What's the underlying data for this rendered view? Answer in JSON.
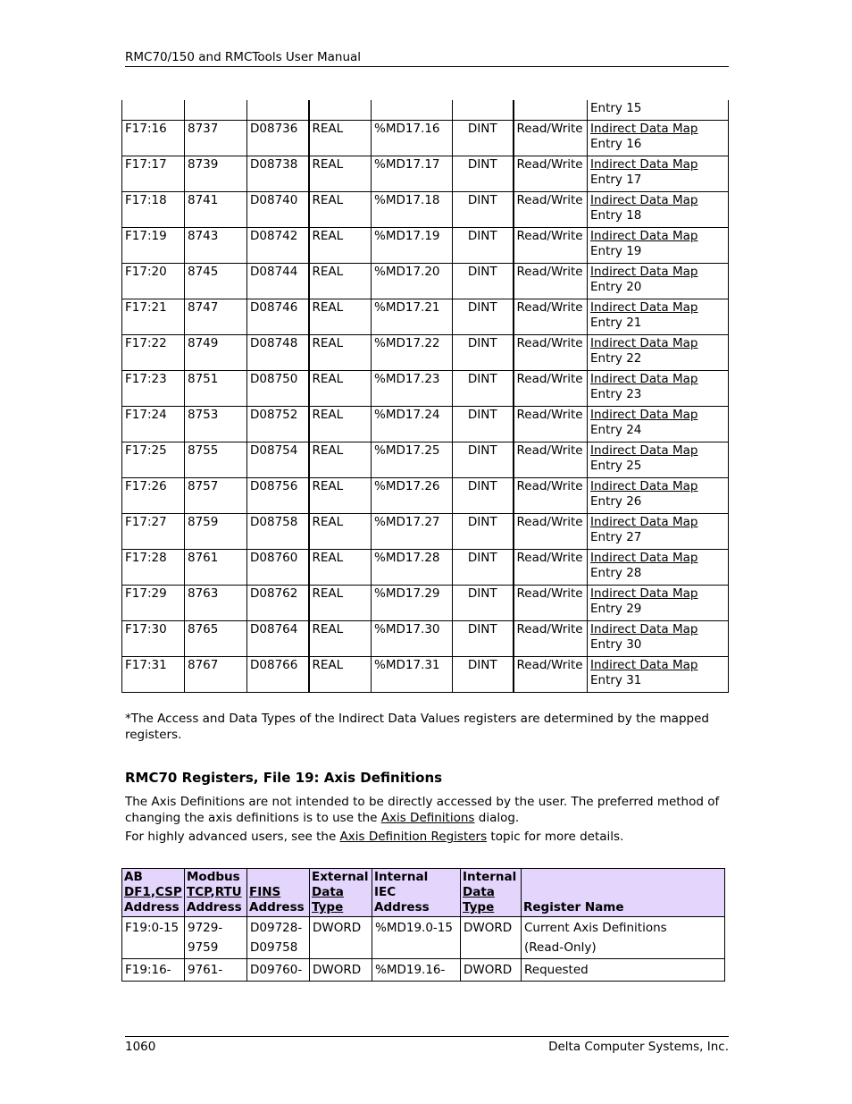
{
  "header": {
    "title": "RMC70/150 and RMCTools User Manual"
  },
  "footer": {
    "page_number": "1060",
    "company": "Delta Computer Systems, Inc."
  },
  "table1": {
    "first_row_continuation": "Entry 15",
    "rows": [
      {
        "ab": "F17:16",
        "modbus": "8737",
        "fins": "D08736",
        "ext": "REAL",
        "iec": "%MD17.16",
        "int": "DINT",
        "access": "Read/Write",
        "name_link": "Indirect Data Map",
        "name_rest": "Entry 16"
      },
      {
        "ab": "F17:17",
        "modbus": "8739",
        "fins": "D08738",
        "ext": "REAL",
        "iec": "%MD17.17",
        "int": "DINT",
        "access": "Read/Write",
        "name_link": "Indirect Data Map",
        "name_rest": "Entry 17"
      },
      {
        "ab": "F17:18",
        "modbus": "8741",
        "fins": "D08740",
        "ext": "REAL",
        "iec": "%MD17.18",
        "int": "DINT",
        "access": "Read/Write",
        "name_link": "Indirect Data Map",
        "name_rest": "Entry 18"
      },
      {
        "ab": "F17:19",
        "modbus": "8743",
        "fins": "D08742",
        "ext": "REAL",
        "iec": "%MD17.19",
        "int": "DINT",
        "access": "Read/Write",
        "name_link": "Indirect Data Map",
        "name_rest": "Entry 19"
      },
      {
        "ab": "F17:20",
        "modbus": "8745",
        "fins": "D08744",
        "ext": "REAL",
        "iec": "%MD17.20",
        "int": "DINT",
        "access": "Read/Write",
        "name_link": "Indirect Data Map",
        "name_rest": "Entry 20"
      },
      {
        "ab": "F17:21",
        "modbus": "8747",
        "fins": "D08746",
        "ext": "REAL",
        "iec": "%MD17.21",
        "int": "DINT",
        "access": "Read/Write",
        "name_link": "Indirect Data Map",
        "name_rest": "Entry 21"
      },
      {
        "ab": "F17:22",
        "modbus": "8749",
        "fins": "D08748",
        "ext": "REAL",
        "iec": "%MD17.22",
        "int": "DINT",
        "access": "Read/Write",
        "name_link": "Indirect Data Map",
        "name_rest": "Entry 22"
      },
      {
        "ab": "F17:23",
        "modbus": "8751",
        "fins": "D08750",
        "ext": "REAL",
        "iec": "%MD17.23",
        "int": "DINT",
        "access": "Read/Write",
        "name_link": "Indirect Data Map",
        "name_rest": "Entry 23"
      },
      {
        "ab": "F17:24",
        "modbus": "8753",
        "fins": "D08752",
        "ext": "REAL",
        "iec": "%MD17.24",
        "int": "DINT",
        "access": "Read/Write",
        "name_link": "Indirect Data Map",
        "name_rest": "Entry 24"
      },
      {
        "ab": "F17:25",
        "modbus": "8755",
        "fins": "D08754",
        "ext": "REAL",
        "iec": "%MD17.25",
        "int": "DINT",
        "access": "Read/Write",
        "name_link": "Indirect Data Map",
        "name_rest": "Entry 25"
      },
      {
        "ab": "F17:26",
        "modbus": "8757",
        "fins": "D08756",
        "ext": "REAL",
        "iec": "%MD17.26",
        "int": "DINT",
        "access": "Read/Write",
        "name_link": "Indirect Data Map",
        "name_rest": "Entry 26"
      },
      {
        "ab": "F17:27",
        "modbus": "8759",
        "fins": "D08758",
        "ext": "REAL",
        "iec": "%MD17.27",
        "int": "DINT",
        "access": "Read/Write",
        "name_link": "Indirect Data Map",
        "name_rest": "Entry 27"
      },
      {
        "ab": "F17:28",
        "modbus": "8761",
        "fins": "D08760",
        "ext": "REAL",
        "iec": "%MD17.28",
        "int": "DINT",
        "access": "Read/Write",
        "name_link": "Indirect Data Map",
        "name_rest": "Entry 28"
      },
      {
        "ab": "F17:29",
        "modbus": "8763",
        "fins": "D08762",
        "ext": "REAL",
        "iec": "%MD17.29",
        "int": "DINT",
        "access": "Read/Write",
        "name_link": "Indirect Data Map",
        "name_rest": "Entry 29"
      },
      {
        "ab": "F17:30",
        "modbus": "8765",
        "fins": "D08764",
        "ext": "REAL",
        "iec": "%MD17.30",
        "int": "DINT",
        "access": "Read/Write",
        "name_link": "Indirect Data Map",
        "name_rest": "Entry 30"
      },
      {
        "ab": "F17:31",
        "modbus": "8767",
        "fins": "D08766",
        "ext": "REAL",
        "iec": "%MD17.31",
        "int": "DINT",
        "access": "Read/Write",
        "name_link": "Indirect Data Map",
        "name_rest": "Entry 31"
      }
    ]
  },
  "note": "*The Access and Data Types of the Indirect Data Values registers are determined by the mapped registers.",
  "section": {
    "heading": "RMC70 Registers, File 19: Axis Definitions",
    "p1_before": "The Axis Definitions are not intended to be directly accessed by the user. The preferred method of changing the axis definitions is to use the ",
    "p1_link": "Axis Definitions",
    "p1_after": " dialog.",
    "p2_before": "For highly advanced users, see the ",
    "p2_link": "Axis Definition Registers",
    "p2_after": " topic for more details."
  },
  "table2": {
    "header_bg": "#e3d5fb",
    "headers": {
      "ab_l1": "AB",
      "ab_l2a": "DF1",
      "ab_l2b": "CSP",
      "ab_l3": "Address",
      "modbus_l1": "Modbus",
      "modbus_l2a": "TCP",
      "modbus_l2b": "RTU",
      "modbus_l3": "Address",
      "fins_l1": "FINS",
      "fins_l2": "Address",
      "ext_l1": "External",
      "ext_l2": "Data",
      "ext_l3": "Type",
      "iec_l1": "Internal",
      "iec_l2": "IEC",
      "iec_l3": "Address",
      "int_l1": "Internal",
      "int_l2": "Data",
      "int_l3": "Type",
      "name": "Register Name"
    },
    "rows": [
      {
        "ab": "F19:0-15",
        "modbus": "9729-\n9759",
        "fins": "D09728-\nD09758",
        "ext": "DWORD",
        "iec": "%MD19.0-15",
        "int": "DWORD",
        "name": "Current Axis Definitions\n(Read-Only)"
      },
      {
        "ab": "F19:16-",
        "modbus": "9761-",
        "fins": "D09760-",
        "ext": "DWORD",
        "iec": "%MD19.16-",
        "int": "DWORD",
        "name": "Requested"
      }
    ]
  }
}
